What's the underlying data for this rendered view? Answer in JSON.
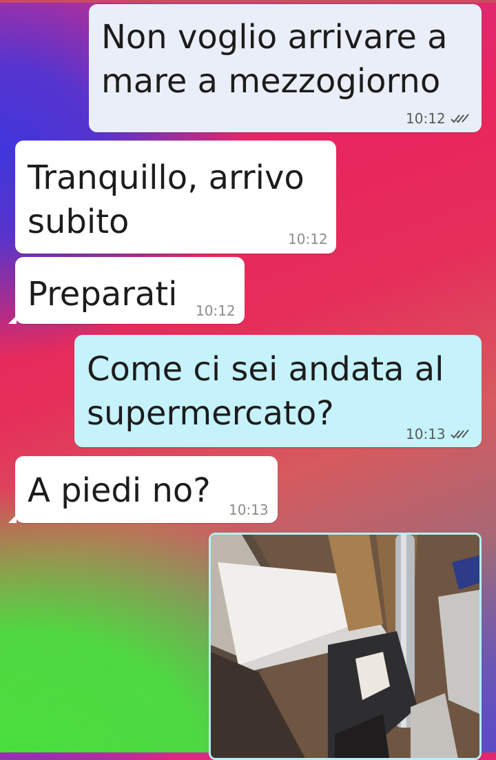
{
  "chat": {
    "messages": [
      {
        "direction": "outgoing",
        "text": "Non voglio arrivare a\nmare a mezzogiorno",
        "time": "10:12",
        "status": "read",
        "status_icon": "double-check-icon"
      },
      {
        "direction": "incoming",
        "text": "Tranquillo, arrivo\nsubito",
        "time": "10:12"
      },
      {
        "direction": "incoming",
        "text": "Preparati",
        "time": "10:12"
      },
      {
        "direction": "outgoing",
        "text": "Come ci sei andata al\nsupermercato?",
        "time": "10:13",
        "status": "read",
        "status_icon": "double-check-icon"
      },
      {
        "direction": "incoming",
        "text": "A piedi no?",
        "time": "10:13"
      },
      {
        "direction": "outgoing",
        "type": "image",
        "content": "photo-thumbnail"
      }
    ]
  },
  "colors": {
    "outgoing_bubble": "#e9eef8",
    "outgoing_bubble_tinted": "#c6f2fb",
    "incoming_bubble": "#ffffff",
    "wallpaper_pink": "#e8265e",
    "wallpaper_blue": "#4036dc",
    "wallpaper_green": "#4ade3e"
  }
}
